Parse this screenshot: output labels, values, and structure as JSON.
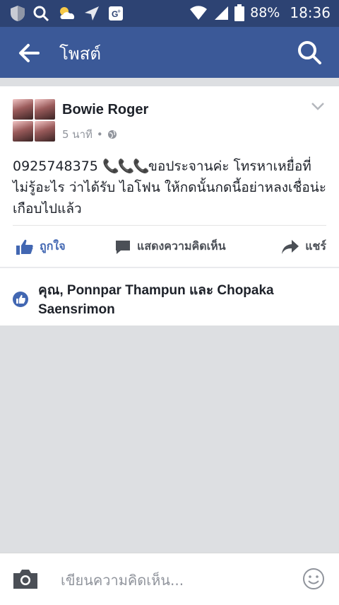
{
  "status_bar": {
    "battery": "88%",
    "time": "18:36",
    "icons": [
      "shield-icon",
      "search-icon",
      "weather-icon",
      "navigation-icon",
      "g-plus-icon",
      "wifi-icon",
      "signal-icon",
      "battery-icon"
    ]
  },
  "app_bar": {
    "title": "โพสต์",
    "back_icon": "arrow-left-icon",
    "search_icon": "search-icon",
    "color": "#3b5998"
  },
  "post": {
    "author": "Bowie Roger",
    "time": "5 นาที",
    "separator": "•",
    "privacy_icon": "globe-icon",
    "text_before": "0925748375 ",
    "text_after": "ขอประจานค่ะ โทรหาเหยื่อที่ไม่รู้อะไร ว่าได้รับ ไอโฟน ให้กดนั้นกดนี้อย่าหลงเชื่อน่ะ เกือบไปแล้ว",
    "phone_emojis": "📞📞📞"
  },
  "actions": {
    "like": "ถูกใจ",
    "comment": "แสดงความคิดเห็น",
    "share": "แชร์"
  },
  "likes_summary": "คุณ, Ponnpar Thampun และ Chopaka Saensrimon",
  "composer": {
    "placeholder": "เขียนความคิดเห็น..."
  },
  "colors": {
    "brand": "#3b5998",
    "status_bar": "#2d4373",
    "like_blue": "#4267b2",
    "background": "#dddfe2"
  }
}
